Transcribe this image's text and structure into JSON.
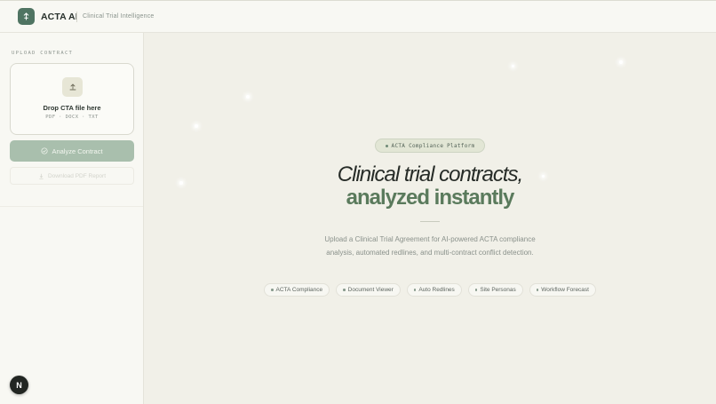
{
  "header": {
    "brand": "ACTA AI",
    "tagline": "Clinical Trial Intelligence",
    "logo_icon": "upload-arrow-icon",
    "accent": "#4f7462"
  },
  "sidebar": {
    "section_label": "UPLOAD CONTRACT",
    "dropzone": {
      "title": "Drop CTA file here",
      "formats": "PDF · DOCX · TXT"
    },
    "analyze_label": "Analyze Contract",
    "download_label": "Download PDF Report"
  },
  "hero": {
    "badge": "ACTA Compliance Platform",
    "title_line1": "Clinical trial contracts,",
    "title_line2": "analyzed instantly",
    "description": "Upload a Clinical Trial Agreement for AI-powered ACTA compliance analysis, automated redlines, and multi-contract conflict detection.",
    "chips": [
      "ACTA Compliance",
      "Document Viewer",
      "Auto Redlines",
      "Site Personas",
      "Workflow Forecast"
    ]
  },
  "fab": {
    "label": "N"
  }
}
